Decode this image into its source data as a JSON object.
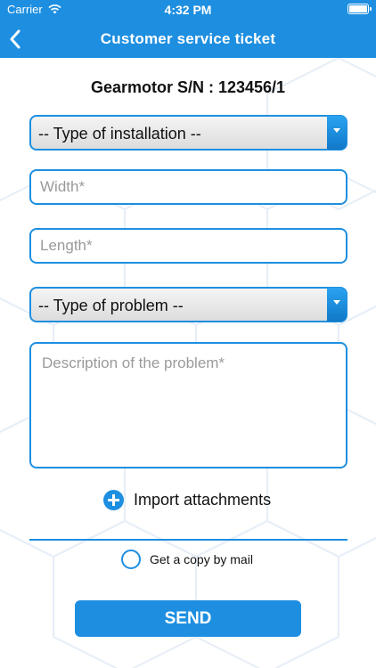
{
  "status_bar": {
    "carrier": "Carrier",
    "time": "4:32 PM"
  },
  "nav": {
    "title": "Customer service ticket"
  },
  "serial_label": "Gearmotor S/N : 123456/1",
  "installation_select": {
    "selected": "-- Type of installation --"
  },
  "width_field": {
    "placeholder": "Width*",
    "value": ""
  },
  "length_field": {
    "placeholder": "Length*",
    "value": ""
  },
  "problem_select": {
    "selected": "-- Type of problem --"
  },
  "description_field": {
    "placeholder": "Description of the problem*",
    "value": ""
  },
  "import_label": "Import attachments",
  "copy_label": "Get a copy by mail",
  "send_label": "SEND",
  "colors": {
    "accent": "#1e8fe0",
    "background": "#ffffff"
  },
  "icons": {
    "back": "chevron-left-icon",
    "wifi": "wifi-icon",
    "battery": "battery-icon",
    "select_arrow": "caret-down-icon",
    "add": "plus-circle-icon",
    "radio": "radio-icon"
  }
}
